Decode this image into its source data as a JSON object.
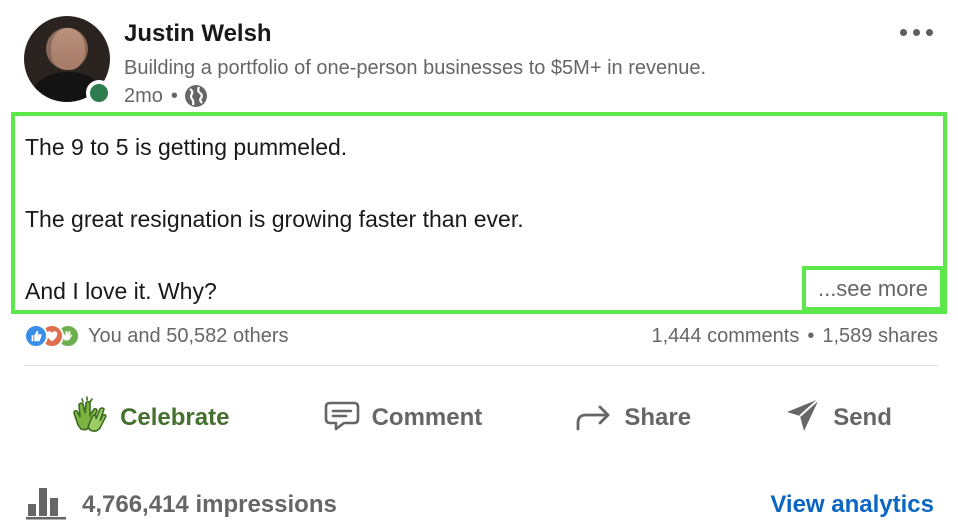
{
  "author": {
    "name": "Justin Welsh",
    "headline": "Building a portfolio of one-person businesses to $5M+ in revenue.",
    "time_ago": "2mo",
    "separator": "•",
    "status": "online"
  },
  "post": {
    "lines": [
      "The 9 to 5 is getting pummeled.",
      "The great resignation is growing faster than ever.",
      "And I love it. Why?"
    ],
    "see_more_label": "...see more"
  },
  "social": {
    "reaction_icons": [
      "like-icon",
      "love-icon",
      "celebrate-icon"
    ],
    "reactions_text": "You and 50,582 others",
    "comments": "1,444 comments",
    "separator": "•",
    "shares": "1,589 shares"
  },
  "actions": {
    "celebrate": "Celebrate",
    "comment": "Comment",
    "share": "Share",
    "send": "Send"
  },
  "analytics": {
    "impressions": "4,766,414 impressions",
    "view_analytics": "View analytics"
  },
  "colors": {
    "highlight": "#5ce84b",
    "celebrate": "#44712e",
    "link": "#0a66c2",
    "status": "#2e7d4f"
  }
}
